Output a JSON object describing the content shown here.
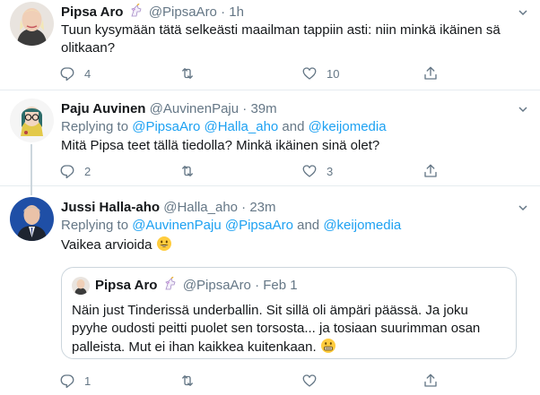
{
  "tweets": [
    {
      "name": "Pipsa Aro",
      "handle": "@PipsaAro",
      "dot": "·",
      "time": "1h",
      "text": "Tuun kysymään tätä selkeästi maailman tappiin asti: niin minkä ikäinen sä olitkaan?",
      "replies": "4",
      "retweets": "",
      "likes": "10"
    },
    {
      "name": "Paju Auvinen",
      "handle": "@AuvinenPaju",
      "dot": "·",
      "time": "39m",
      "replying_prefix": "Replying to ",
      "replying_to_1": "@PipsaAro",
      "replying_to_2": "@Halla_aho",
      "replying_and": " and ",
      "replying_to_3": "@keijomedia",
      "text": "Mitä Pipsa teet tällä tiedolla? Minkä ikäinen sinä olet?",
      "replies": "2",
      "retweets": "",
      "likes": "3"
    },
    {
      "name": "Jussi Halla-aho",
      "handle": "@Halla_aho",
      "dot": "·",
      "time": "23m",
      "replying_prefix": "Replying to ",
      "replying_to_1": "@AuvinenPaju",
      "replying_to_2": "@PipsaAro",
      "replying_and": " and ",
      "replying_to_3": "@keijomedia",
      "text": "Vaikea arvioida",
      "emoji": "grinning-face",
      "replies": "1",
      "retweets": "",
      "likes": "",
      "quoted": {
        "name": "Pipsa Aro",
        "handle": "@PipsaAro",
        "dot": "·",
        "time": "Feb 1",
        "text": "Näin just Tinderissä underballin. Sit sillä oli ämpäri päässä. Ja joku pyyhe oudosti peitti puolet sen torsosta... ja tosiaan suurimman osan palleista. Mut ei ihan kaikkea kuitenkaan.",
        "emoji": "grimacing-face"
      }
    }
  ],
  "icons": {
    "reply": "reply-icon",
    "retweet": "retweet-icon",
    "like": "heart-icon",
    "share": "share-icon",
    "unicorn": "unicorn-emoji",
    "caret": "chevron-down-icon"
  },
  "colors": {
    "link": "#1da1f2",
    "muted": "#657786",
    "border": "#e6ecf0",
    "text": "#14171a"
  }
}
